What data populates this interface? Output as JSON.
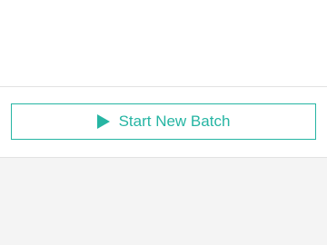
{
  "actions": {
    "start_label": "Start New Batch",
    "start_icon": "play-icon",
    "accent_color": "#26b5a3"
  },
  "colors": {
    "divider": "#e2e2e2",
    "footer_background": "#f4f4f4"
  }
}
